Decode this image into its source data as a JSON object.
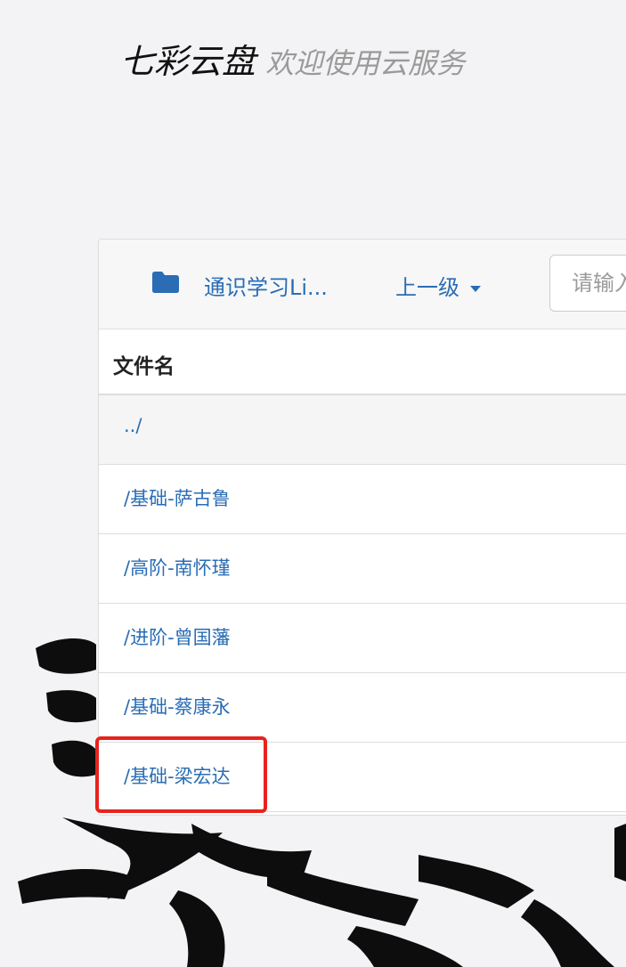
{
  "header": {
    "brand": "七彩云盘",
    "tagline": "欢迎使用云服务"
  },
  "toolbar": {
    "folder_icon": "folder-icon",
    "current_folder": "通识学习Li...",
    "up_level_label": "上一级",
    "search_placeholder": "请输入"
  },
  "table": {
    "column_header": "文件名",
    "rows": [
      {
        "label": "../"
      },
      {
        "label": "/基础-萨古鲁"
      },
      {
        "label": "/高阶-南怀瑾"
      },
      {
        "label": "/进阶-曾国藩"
      },
      {
        "label": "/基础-蔡康永"
      },
      {
        "label": "/基础-梁宏达"
      }
    ]
  },
  "colors": {
    "link": "#2a6db4",
    "highlight": "#e8221e"
  }
}
